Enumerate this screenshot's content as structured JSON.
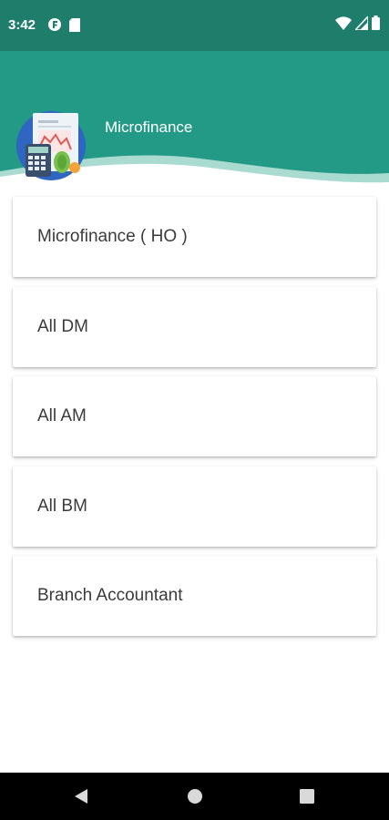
{
  "status_bar": {
    "time": "3:42",
    "left_icons": [
      "app-notification-icon",
      "sd-card-icon"
    ],
    "right_icons": [
      "wifi-icon",
      "cell-signal-icon",
      "battery-icon"
    ]
  },
  "header": {
    "title": "Microfinance",
    "logo_icon": "finance-report-calculator-icon",
    "color": "#239a86"
  },
  "menu": {
    "items": [
      {
        "label": "Microfinance ( HO )"
      },
      {
        "label": "All DM"
      },
      {
        "label": "All AM"
      },
      {
        "label": "All BM"
      },
      {
        "label": "Branch Accountant"
      }
    ]
  },
  "nav_bar": {
    "buttons": [
      "back-icon",
      "home-icon",
      "recents-icon"
    ]
  },
  "colors": {
    "status_bar": "#1f7d6c",
    "header": "#239a86",
    "wave": "#a9dbd1",
    "card_text": "#3b3b3b"
  }
}
